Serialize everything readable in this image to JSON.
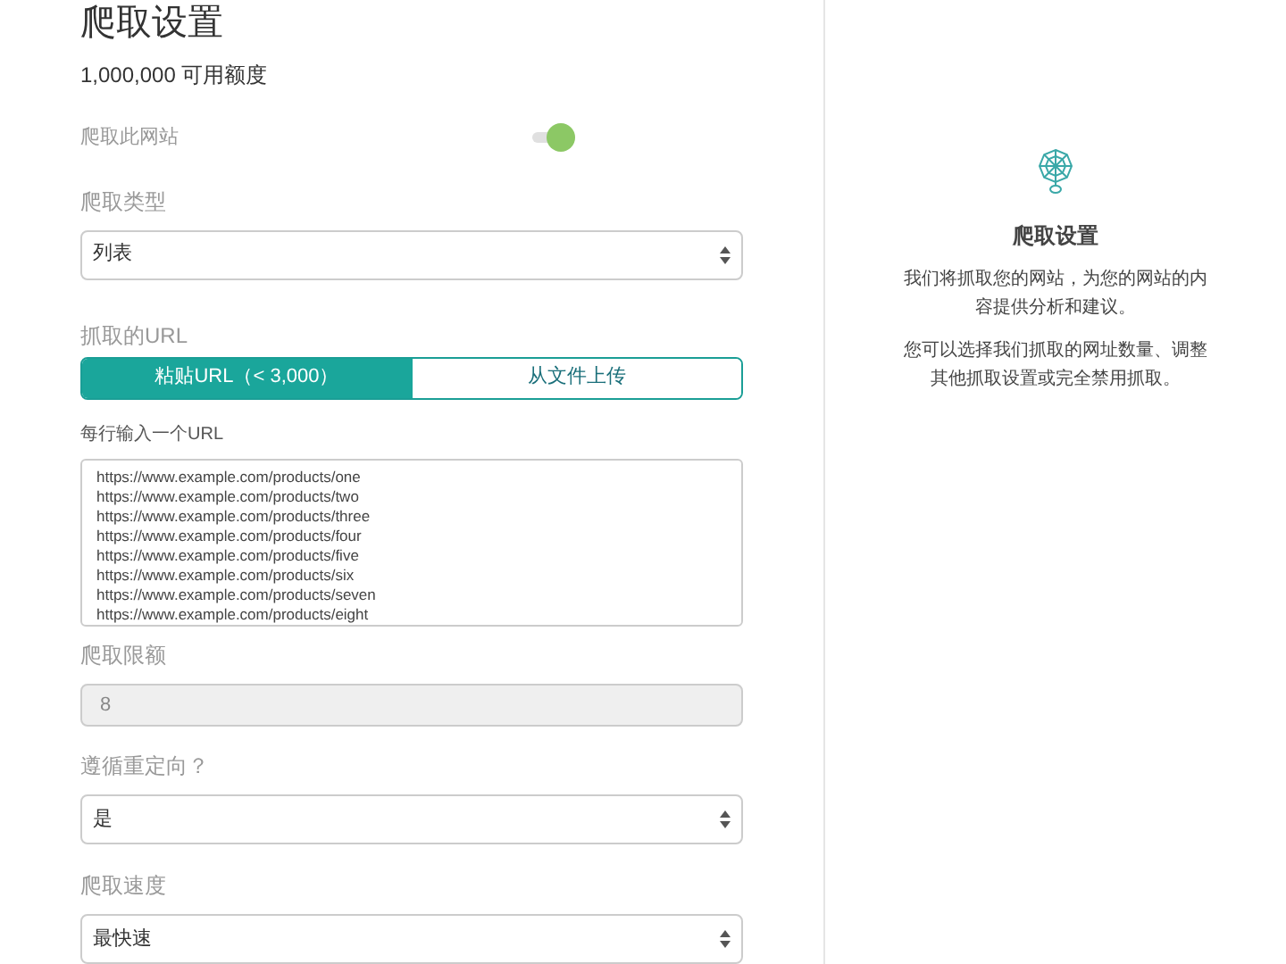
{
  "title": "爬取设置",
  "credits": "1,000,000 可用额度",
  "crawl_toggle": {
    "label": "爬取此网站",
    "on": true
  },
  "crawl_type": {
    "label": "爬取类型",
    "value": "列表"
  },
  "urls": {
    "label": "抓取的URL",
    "tabs": [
      {
        "label": "粘贴URL（< 3,000）",
        "selected": true
      },
      {
        "label": "从文件上传",
        "selected": false
      }
    ],
    "hint": "每行输入一个URL",
    "lines": [
      "https://www.example.com/products/one",
      "https://www.example.com/products/two",
      "https://www.example.com/products/three",
      "https://www.example.com/products/four",
      "https://www.example.com/products/five",
      "https://www.example.com/products/six",
      "https://www.example.com/products/seven",
      "https://www.example.com/products/eight"
    ]
  },
  "limit": {
    "label": "爬取限额",
    "value": "8",
    "disabled": true
  },
  "follow_redirects": {
    "label": "遵循重定向？",
    "value": "是"
  },
  "speed": {
    "label": "爬取速度",
    "value": "最快速"
  },
  "side": {
    "title": "爬取设置",
    "paragraphs": [
      "我们将抓取您的网站，为您的网站的内容提供分析和建议。",
      "您可以选择我们抓取的网址数量、调整其他抓取设置或完全禁用抓取。"
    ]
  }
}
